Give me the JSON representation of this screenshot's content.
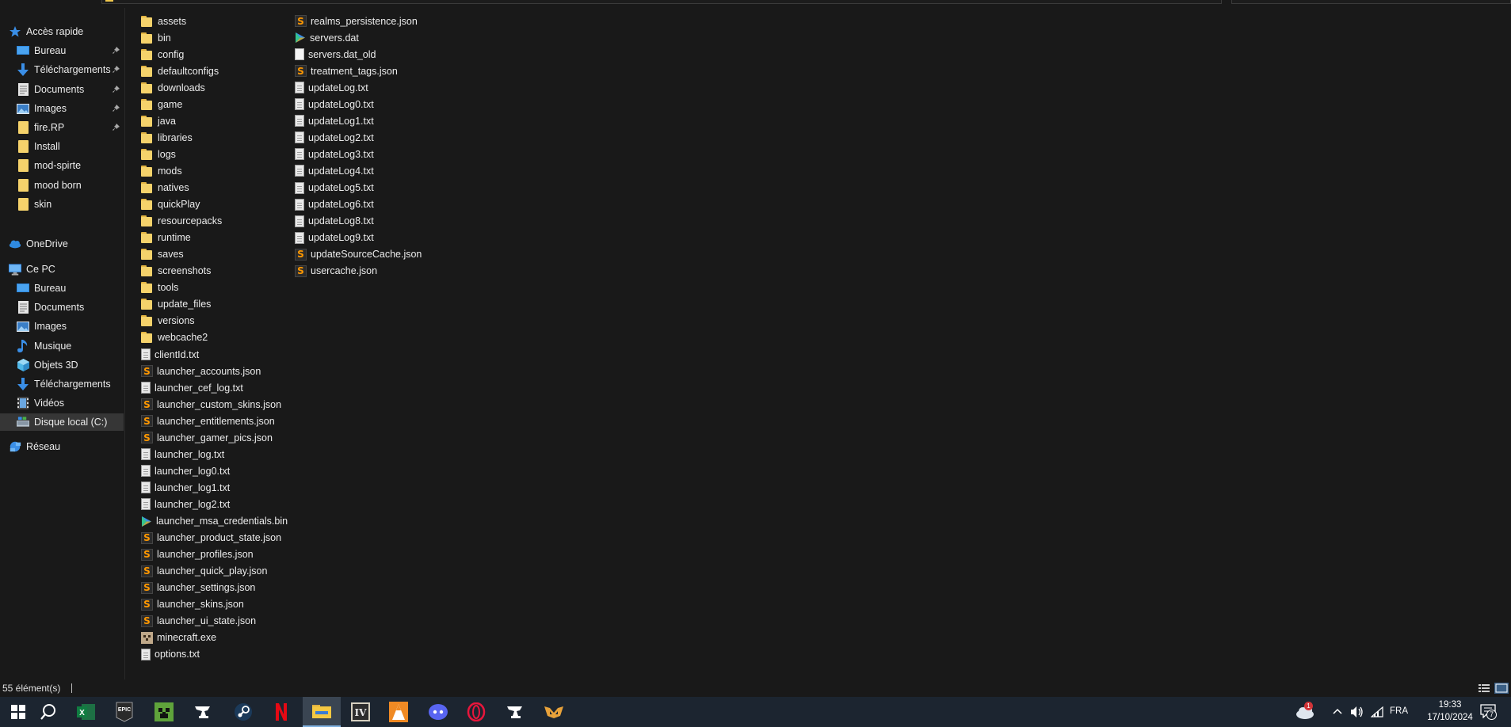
{
  "nav": {
    "quick_access": "Accès rapide",
    "quick_items": [
      {
        "label": "Bureau",
        "icon": "desktop-icon",
        "pinned": true
      },
      {
        "label": "Téléchargements",
        "icon": "download-icon",
        "pinned": true
      },
      {
        "label": "Documents",
        "icon": "documents-icon",
        "pinned": true
      },
      {
        "label": "Images",
        "icon": "pictures-icon",
        "pinned": true
      },
      {
        "label": "fire.RP",
        "icon": "folder-icon",
        "pinned": true
      },
      {
        "label": "Install",
        "icon": "folder-icon",
        "pinned": false
      },
      {
        "label": "mod-spirte",
        "icon": "folder-icon",
        "pinned": false
      },
      {
        "label": "mood born",
        "icon": "folder-icon",
        "pinned": false
      },
      {
        "label": "skin",
        "icon": "folder-icon",
        "pinned": false
      }
    ],
    "onedrive": "OneDrive",
    "this_pc": "Ce PC",
    "pc_items": [
      {
        "label": "Bureau",
        "icon": "desktop-icon"
      },
      {
        "label": "Documents",
        "icon": "documents-icon"
      },
      {
        "label": "Images",
        "icon": "pictures-icon"
      },
      {
        "label": "Musique",
        "icon": "music-icon"
      },
      {
        "label": "Objets 3D",
        "icon": "3d-objects-icon"
      },
      {
        "label": "Téléchargements",
        "icon": "download-icon"
      },
      {
        "label": "Vidéos",
        "icon": "videos-icon"
      },
      {
        "label": "Disque local (C:)",
        "icon": "drive-icon",
        "selected": true
      }
    ],
    "network": "Réseau"
  },
  "files_col1": [
    {
      "name": "assets",
      "type": "folder"
    },
    {
      "name": "bin",
      "type": "folder"
    },
    {
      "name": "config",
      "type": "folder"
    },
    {
      "name": "defaultconfigs",
      "type": "folder"
    },
    {
      "name": "downloads",
      "type": "folder"
    },
    {
      "name": "game",
      "type": "folder"
    },
    {
      "name": "java",
      "type": "folder"
    },
    {
      "name": "libraries",
      "type": "folder"
    },
    {
      "name": "logs",
      "type": "folder"
    },
    {
      "name": "mods",
      "type": "folder"
    },
    {
      "name": "natives",
      "type": "folder"
    },
    {
      "name": "quickPlay",
      "type": "folder"
    },
    {
      "name": "resourcepacks",
      "type": "folder"
    },
    {
      "name": "runtime",
      "type": "folder"
    },
    {
      "name": "saves",
      "type": "folder"
    },
    {
      "name": "screenshots",
      "type": "folder"
    },
    {
      "name": "tools",
      "type": "folder"
    },
    {
      "name": "update_files",
      "type": "folder"
    },
    {
      "name": "versions",
      "type": "folder"
    },
    {
      "name": "webcache2",
      "type": "folder"
    },
    {
      "name": "clientId.txt",
      "type": "txt"
    },
    {
      "name": "launcher_accounts.json",
      "type": "json"
    },
    {
      "name": "launcher_cef_log.txt",
      "type": "txt"
    },
    {
      "name": "launcher_custom_skins.json",
      "type": "json"
    },
    {
      "name": "launcher_entitlements.json",
      "type": "json"
    },
    {
      "name": "launcher_gamer_pics.json",
      "type": "json"
    },
    {
      "name": "launcher_log.txt",
      "type": "txt"
    },
    {
      "name": "launcher_log0.txt",
      "type": "txt"
    },
    {
      "name": "launcher_log1.txt",
      "type": "txt"
    },
    {
      "name": "launcher_log2.txt",
      "type": "txt"
    },
    {
      "name": "launcher_msa_credentials.bin",
      "type": "bin"
    },
    {
      "name": "launcher_product_state.json",
      "type": "json"
    },
    {
      "name": "launcher_profiles.json",
      "type": "json"
    },
    {
      "name": "launcher_quick_play.json",
      "type": "json"
    },
    {
      "name": "launcher_settings.json",
      "type": "json"
    },
    {
      "name": "launcher_skins.json",
      "type": "json"
    },
    {
      "name": "launcher_ui_state.json",
      "type": "json"
    },
    {
      "name": "minecraft.exe",
      "type": "exe"
    },
    {
      "name": "options.txt",
      "type": "txt"
    }
  ],
  "files_col2": [
    {
      "name": "realms_persistence.json",
      "type": "json"
    },
    {
      "name": "servers.dat",
      "type": "bin"
    },
    {
      "name": "servers.dat_old",
      "type": "blank"
    },
    {
      "name": "treatment_tags.json",
      "type": "json"
    },
    {
      "name": "updateLog.txt",
      "type": "txt"
    },
    {
      "name": "updateLog0.txt",
      "type": "txt"
    },
    {
      "name": "updateLog1.txt",
      "type": "txt"
    },
    {
      "name": "updateLog2.txt",
      "type": "txt"
    },
    {
      "name": "updateLog3.txt",
      "type": "txt"
    },
    {
      "name": "updateLog4.txt",
      "type": "txt"
    },
    {
      "name": "updateLog5.txt",
      "type": "txt"
    },
    {
      "name": "updateLog6.txt",
      "type": "txt"
    },
    {
      "name": "updateLog8.txt",
      "type": "txt"
    },
    {
      "name": "updateLog9.txt",
      "type": "txt"
    },
    {
      "name": "updateSourceCache.json",
      "type": "json"
    },
    {
      "name": "usercache.json",
      "type": "json"
    }
  ],
  "status": {
    "item_count": "55 élément(s)"
  },
  "taskbar": {
    "apps": [
      "start-icon",
      "search-icon",
      "excel-icon",
      "epic-games-icon",
      "minecraft-icon",
      "curseforge-icon",
      "steam-icon",
      "netflix-icon",
      "file-explorer-icon",
      "modrinth-icon",
      "vlc-icon",
      "discord-icon",
      "opera-gx-icon",
      "curseforge-icon",
      "overwolf-icon"
    ],
    "epic_label": "EPIC",
    "weather_badge": "1",
    "language": "FRA",
    "time": "19:33",
    "date": "17/10/2024",
    "notifications": "7"
  },
  "colors": {
    "folder": "#f5d26b",
    "sublime": "#ff9800",
    "background": "#191919",
    "taskbar": "#1c2530"
  }
}
